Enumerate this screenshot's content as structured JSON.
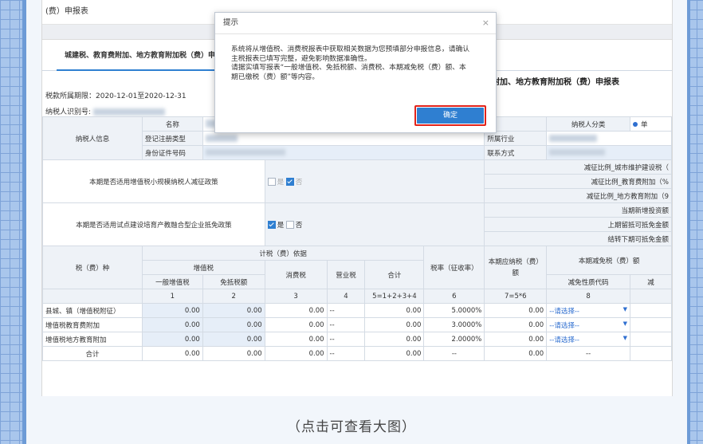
{
  "page": {
    "title_fragment": "(费）申报表",
    "tab_label": "城建税、教育费附加、地方教育附加税（费）申",
    "right_title": "附加、地方教育附加税（费）申报表",
    "period": "税款所属期限：2020-12-01至2020-12-31",
    "taxpayer_id_label": "纳税人识别号:"
  },
  "modal": {
    "title": "提示",
    "close_glyph": "×",
    "message": "系统将从增值税、消费税报表中获取相关数据为您预填部分申报信息，请确认主税报表已填写完整，避免影响数据准确性。\n请据实填写报表“一般增值税、免抵税额、消费税、本期减免税（费）额、本期已缴税（费）额”等内容。",
    "confirm_label": "确定"
  },
  "info": {
    "taxpayer_info_label": "纳税人信息",
    "name_label": "名称",
    "reg_type_label": "登记注册类型",
    "id_type_label": "身份证件号码",
    "industry_label": "所属行业",
    "contact_label": "联系方式",
    "category_label": "纳税人分类",
    "category_option": "单"
  },
  "policy": {
    "small_scale_question": "本期是否适用增值税小规模纳税人减征政策",
    "yes": "是",
    "no": "否",
    "reduce_city": "减征比例_城市维护建设税（",
    "reduce_edu": "减征比例_教育费附加（%",
    "reduce_local": "减征比例_地方教育附加（9",
    "pilot_question": "本期是否适用试点建设培育产教融合型企业抵免政策",
    "new_invest": "当期新增投资额",
    "prev_credit": "上期留抵可抵免金额",
    "carry_credit": "结转下期可抵免金额"
  },
  "table": {
    "tax_type_header": "税（费）种",
    "basis_header": "计税（费）依据",
    "vat_header": "增值税",
    "general_vat": "一般增值税",
    "exempt_credit": "免抵税额",
    "consumption_tax": "消费税",
    "business_tax": "营业税",
    "total_header": "合计",
    "rate_header": "税率（征收率）",
    "payable_header": "本期应纳税（费）额",
    "relief_header": "本期减免税（费）额",
    "relief_code": "减免性质代码",
    "relief_amount_trunc": "减",
    "col_numbers": [
      "1",
      "2",
      "3",
      "4",
      "5=1+2+3+4",
      "6",
      "7=5*6",
      "8"
    ],
    "rows": [
      {
        "name": "县城、镇（增值税附征）",
        "c1": "0.00",
        "c2": "0.00",
        "c3": "0.00",
        "c4": "--",
        "c5": "0.00",
        "c6": "5.0000%",
        "c7": "0.00",
        "c8": "--请选择--"
      },
      {
        "name": "增值税教育费附加",
        "c1": "0.00",
        "c2": "0.00",
        "c3": "0.00",
        "c4": "--",
        "c5": "0.00",
        "c6": "3.0000%",
        "c7": "0.00",
        "c8": "--请选择--"
      },
      {
        "name": "增值税地方教育附加",
        "c1": "0.00",
        "c2": "0.00",
        "c3": "0.00",
        "c4": "--",
        "c5": "0.00",
        "c6": "2.0000%",
        "c7": "0.00",
        "c8": "--请选择--"
      }
    ],
    "total_row": {
      "name": "合计",
      "c1": "0.00",
      "c2": "0.00",
      "c3": "0.00",
      "c4": "--",
      "c5": "0.00",
      "c6": "--",
      "c7": "0.00",
      "c8": "--"
    }
  },
  "caption": "（点击可查看大图）"
}
